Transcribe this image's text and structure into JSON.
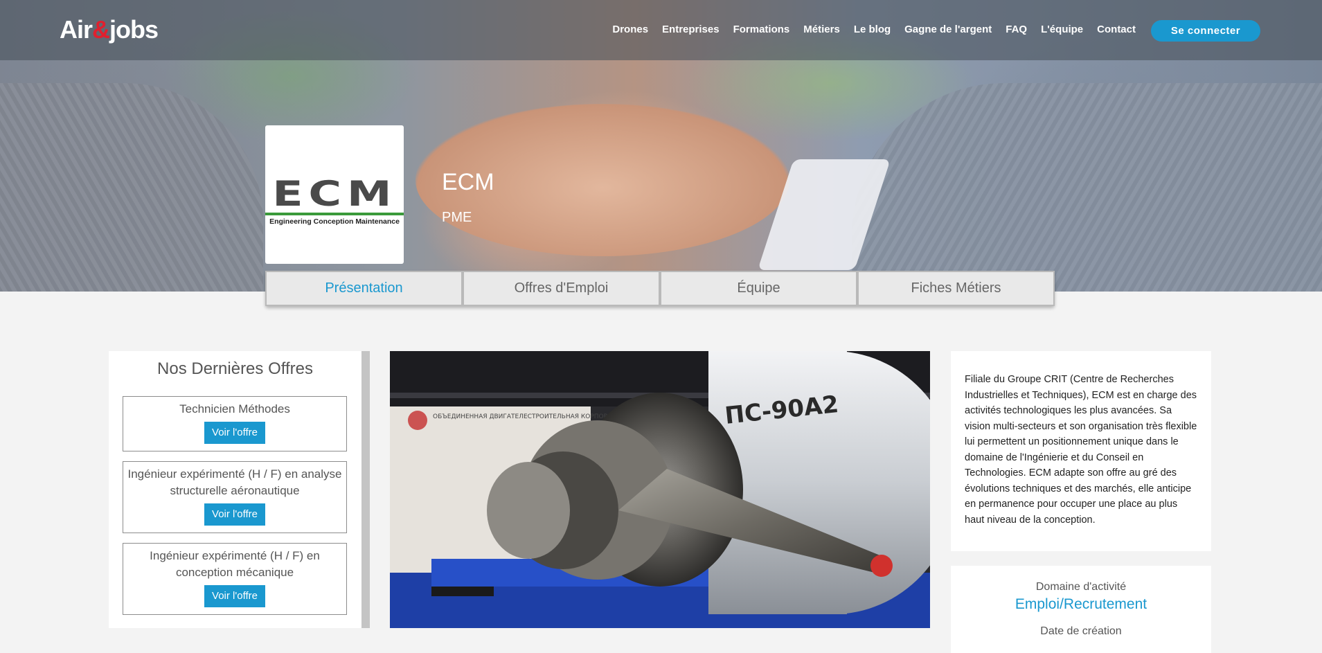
{
  "header": {
    "logo_left": "Air",
    "logo_amp": "&",
    "logo_right": "jobs",
    "nav": [
      "Drones",
      "Entreprises",
      "Formations",
      "Métiers",
      "Le blog",
      "Gagne de l'argent",
      "FAQ",
      "L'équipe",
      "Contact"
    ],
    "login_label": "Se connecter"
  },
  "company": {
    "logo_text": "ECM",
    "logo_tagline": "Engineering  Conception  Maintenance",
    "name": "ECM",
    "type": "PME"
  },
  "tabs": [
    "Présentation",
    "Offres d'Emploi",
    "Équipe",
    "Fiches Métiers"
  ],
  "offers": {
    "heading": "Nos Dernières Offres",
    "button_label": "Voir l'offre",
    "items": [
      "Technicien Méthodes",
      "Ingénieur expérimenté (H / F) en analyse structurelle aéronautique",
      "Ingénieur expérimenté (H / F) en conception mécanique"
    ]
  },
  "photo": {
    "engine_label": "ПС-90А2",
    "stand_text": "ОБЪЕДИНЕННАЯ ДВИГАТЕЛЕСТРОИТЕЛЬНАЯ КОРПОРАЦИЯ"
  },
  "about": {
    "text": "Filiale du Groupe CRIT (Centre de Recherches Industrielles et Techniques), ECM est en charge des activités technologiques les plus avancées. Sa vision multi-secteurs et son organisation très flexible lui permettent un positionnement unique dans le domaine de l'Ingénierie et du Conseil en Technologies. ECM adapte son offre au gré des évolutions techniques et des marchés, elle anticipe en permanence pour occuper une place au plus haut niveau de la conception."
  },
  "meta": {
    "domain_label": "Domaine d'activité",
    "domain_value": "Emploi/Recrutement",
    "date_label": "Date de création"
  },
  "colors": {
    "accent": "#1a98cf",
    "logo_red": "#e0202e"
  }
}
